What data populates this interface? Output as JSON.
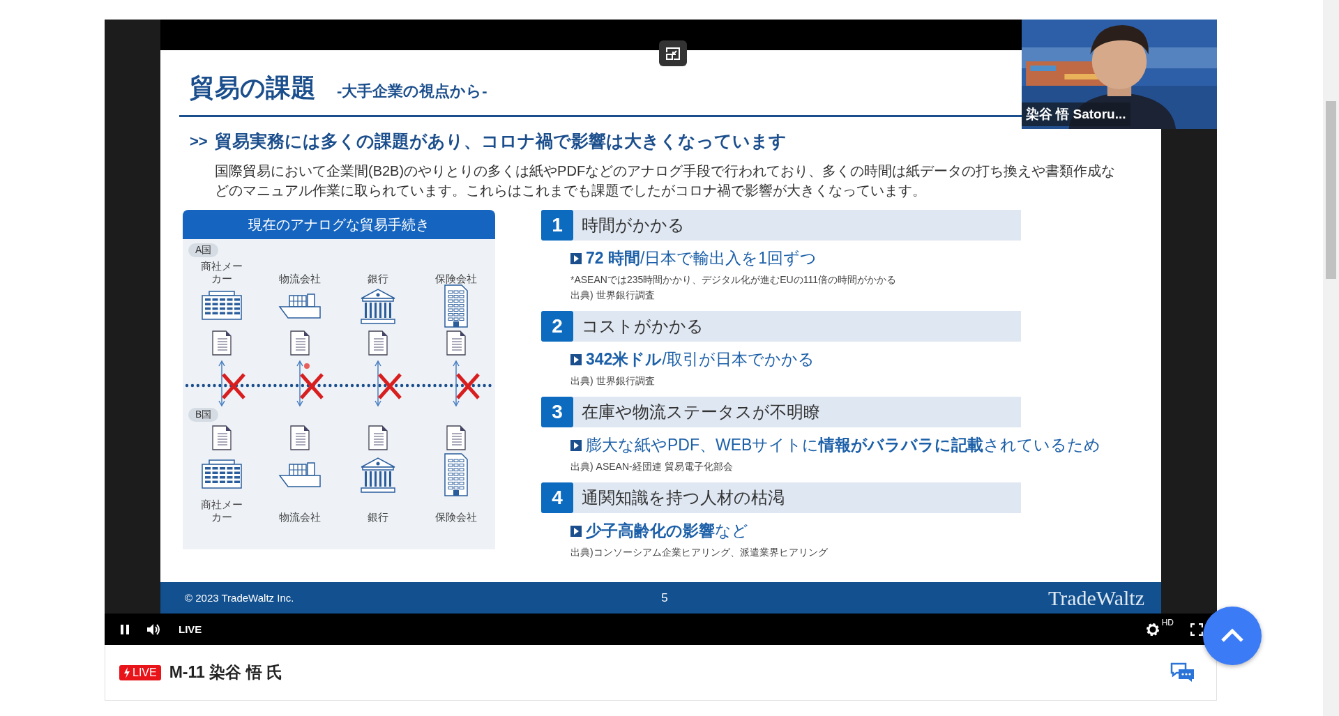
{
  "player": {
    "slide": {
      "title": "貿易の課題",
      "subtitle": "-大手企業の視点から-",
      "headline_marker": ">>",
      "headline": "貿易実務には多くの課題があり、コロナ禍で影響は大きくなっています",
      "body": "国際貿易において企業間(B2B)のやりとりの多くは紙やPDFなどのアナログ手段で行われており、多くの時間は紙データの打ち換えや書類作成などのマニュアル作業に取られています。これらはこれまでも課題でしたがコロナ禍で影響が大きくなっています。",
      "diagram": {
        "title": "現在のアナログな貿易手続き",
        "country_a": "A国",
        "country_b": "B国",
        "top": [
          {
            "kind": "factory",
            "label": "商社メーカー"
          },
          {
            "kind": "ship",
            "label": "物流会社"
          },
          {
            "kind": "bank",
            "label": "銀行"
          },
          {
            "kind": "office",
            "label": "保険会社"
          }
        ],
        "bottom": [
          {
            "kind": "factory",
            "label": "商社メーカー"
          },
          {
            "kind": "ship",
            "label": "物流会社"
          },
          {
            "kind": "bank",
            "label": "銀行"
          },
          {
            "kind": "office",
            "label": "保険会社"
          }
        ]
      },
      "issues": [
        {
          "number": "1",
          "title": "時間がかかる",
          "point": "**72 時間**/日本で輸出入を1回ずつ",
          "notes": [
            "*ASEANでは235時間かかり、デジタル化が進むEUの111倍の時間がかかる",
            "出典) 世界銀行調査"
          ]
        },
        {
          "number": "2",
          "title": "コストがかかる",
          "point": "**342米ドル**/取引が日本でかかる",
          "notes": [
            "出典) 世界銀行調査"
          ]
        },
        {
          "number": "3",
          "title": "在庫や物流ステータスが不明瞭",
          "point": "膨大な紙やPDF、WEBサイトに**情報がバラバラに記載**されているため",
          "notes": [
            "出典) ASEAN-経団連 貿易電子化部会"
          ]
        },
        {
          "number": "4",
          "title": "通関知識を持つ人材の枯渇",
          "point": "**少子高齢化の影響**など",
          "notes": [
            "出典)コンソーシアム企業ヒアリング、派遣業界ヒアリング"
          ]
        }
      ],
      "footer": {
        "copyright": "© 2023 TradeWaltz Inc.",
        "page": "5",
        "logo": "TradeWaltz"
      }
    },
    "webcam": {
      "name": "染谷 悟 Satoru..."
    },
    "controls": {
      "playing": true,
      "live": "LIVE",
      "quality": "HD"
    }
  },
  "stream": {
    "badge": "LIVE",
    "title": "M-11 染谷 悟 氏"
  }
}
